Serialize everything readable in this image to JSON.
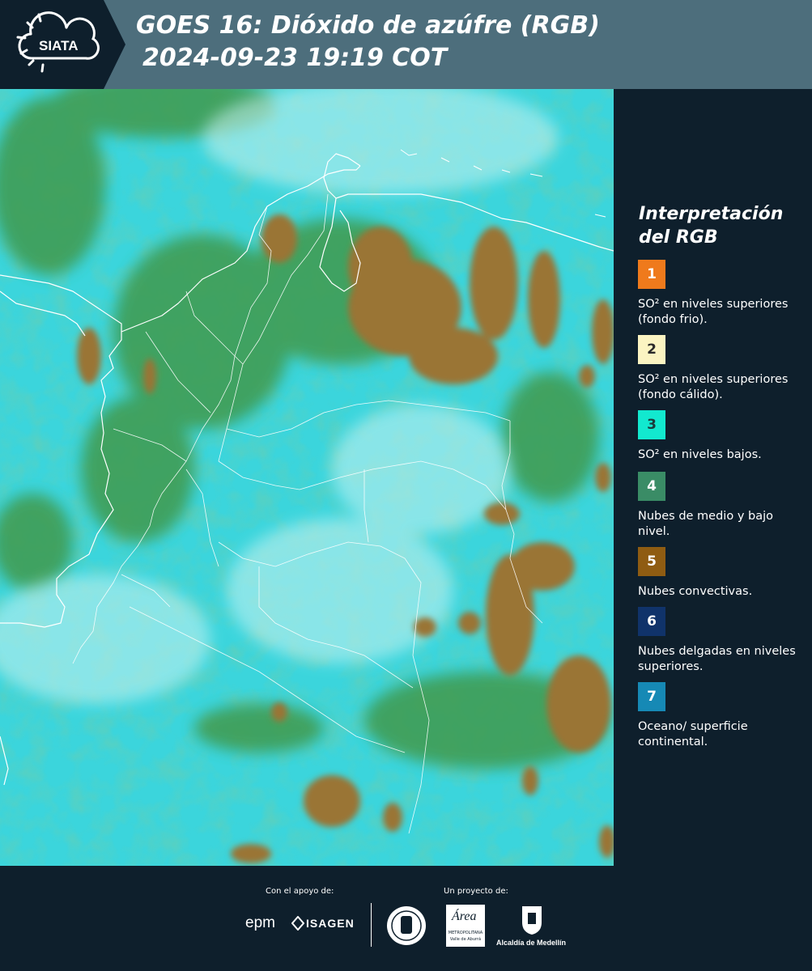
{
  "header": {
    "logo_text": "SIATA",
    "title_line1": "GOES 16: Dióxido de azúfre (RGB)",
    "title_line2": "2024-09-23 19:19 COT"
  },
  "legend": {
    "title_line1": "Interpretación",
    "title_line2": "del RGB",
    "items": [
      {
        "number": "1",
        "color": "#ef7a1c",
        "text_color": "#ffffff",
        "description": "SO² en niveles superiores (fondo frio)."
      },
      {
        "number": "2",
        "color": "#fbf4c2",
        "text_color": "#2a2a2a",
        "description": "SO² en niveles superiores (fondo cálido)."
      },
      {
        "number": "3",
        "color": "#12e9cf",
        "text_color": "#1b3b3b",
        "description": "SO² en niveles bajos."
      },
      {
        "number": "4",
        "color": "#3a8c66",
        "text_color": "#ffffff",
        "description": "Nubes de medio y bajo nivel."
      },
      {
        "number": "5",
        "color": "#8f5c12",
        "text_color": "#ffffff",
        "description": "Nubes convectivas."
      },
      {
        "number": "6",
        "color": "#10336a",
        "text_color": "#ffffff",
        "description": "Nubes delgadas en niveles superiores."
      },
      {
        "number": "7",
        "color": "#1689b5",
        "text_color": "#ffffff",
        "description": "Oceano/ superficie continental."
      }
    ]
  },
  "footer": {
    "support_label": "Con el apoyo de:",
    "project_label": "Un proyecto de:",
    "logo_epm": "epm",
    "logo_isagen": "ISAGEN",
    "logo_area_title": "Área",
    "logo_area_sub": "METROPOLITANA",
    "logo_area_sub2": "Valle de Aburrá",
    "logo_alcaldia": "Alcaldía de Medellín"
  },
  "colors": {
    "header_bg": "#4d6e7c",
    "page_bg": "#0e1f2c",
    "map_cyan": "#3ad6dc",
    "map_green": "#3f9a4e",
    "map_brown": "#9a7434"
  }
}
